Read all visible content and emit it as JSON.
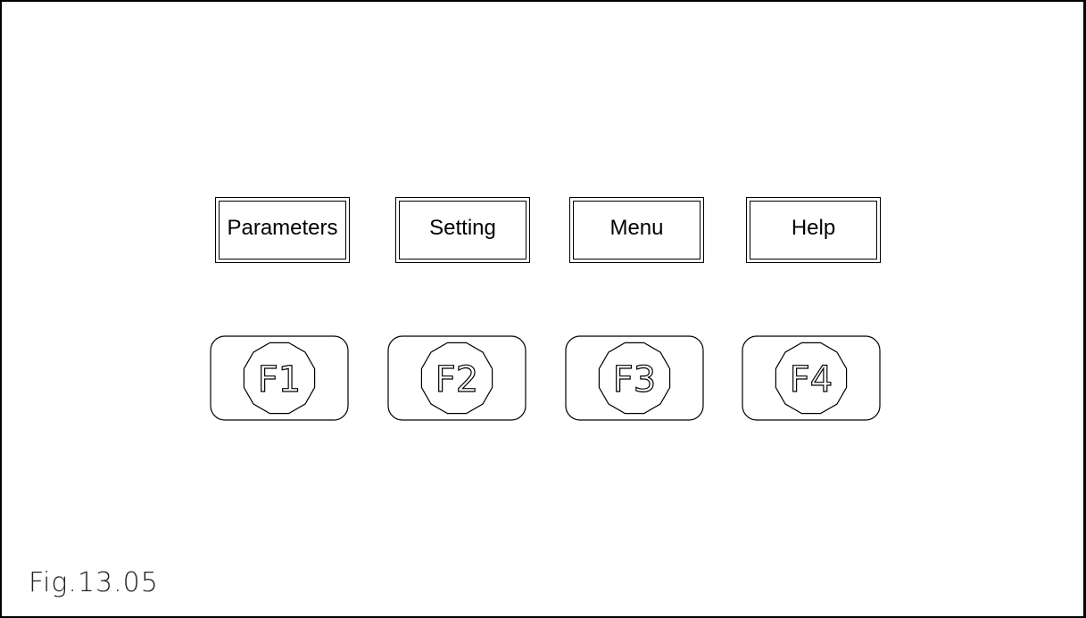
{
  "softkeys": [
    {
      "label": "Parameters"
    },
    {
      "label": "Setting"
    },
    {
      "label": "Menu"
    },
    {
      "label": "Help"
    }
  ],
  "function_keys": [
    {
      "label": "F1"
    },
    {
      "label": "F2"
    },
    {
      "label": "F3"
    },
    {
      "label": "F4"
    }
  ],
  "caption": "Fig.13.05"
}
